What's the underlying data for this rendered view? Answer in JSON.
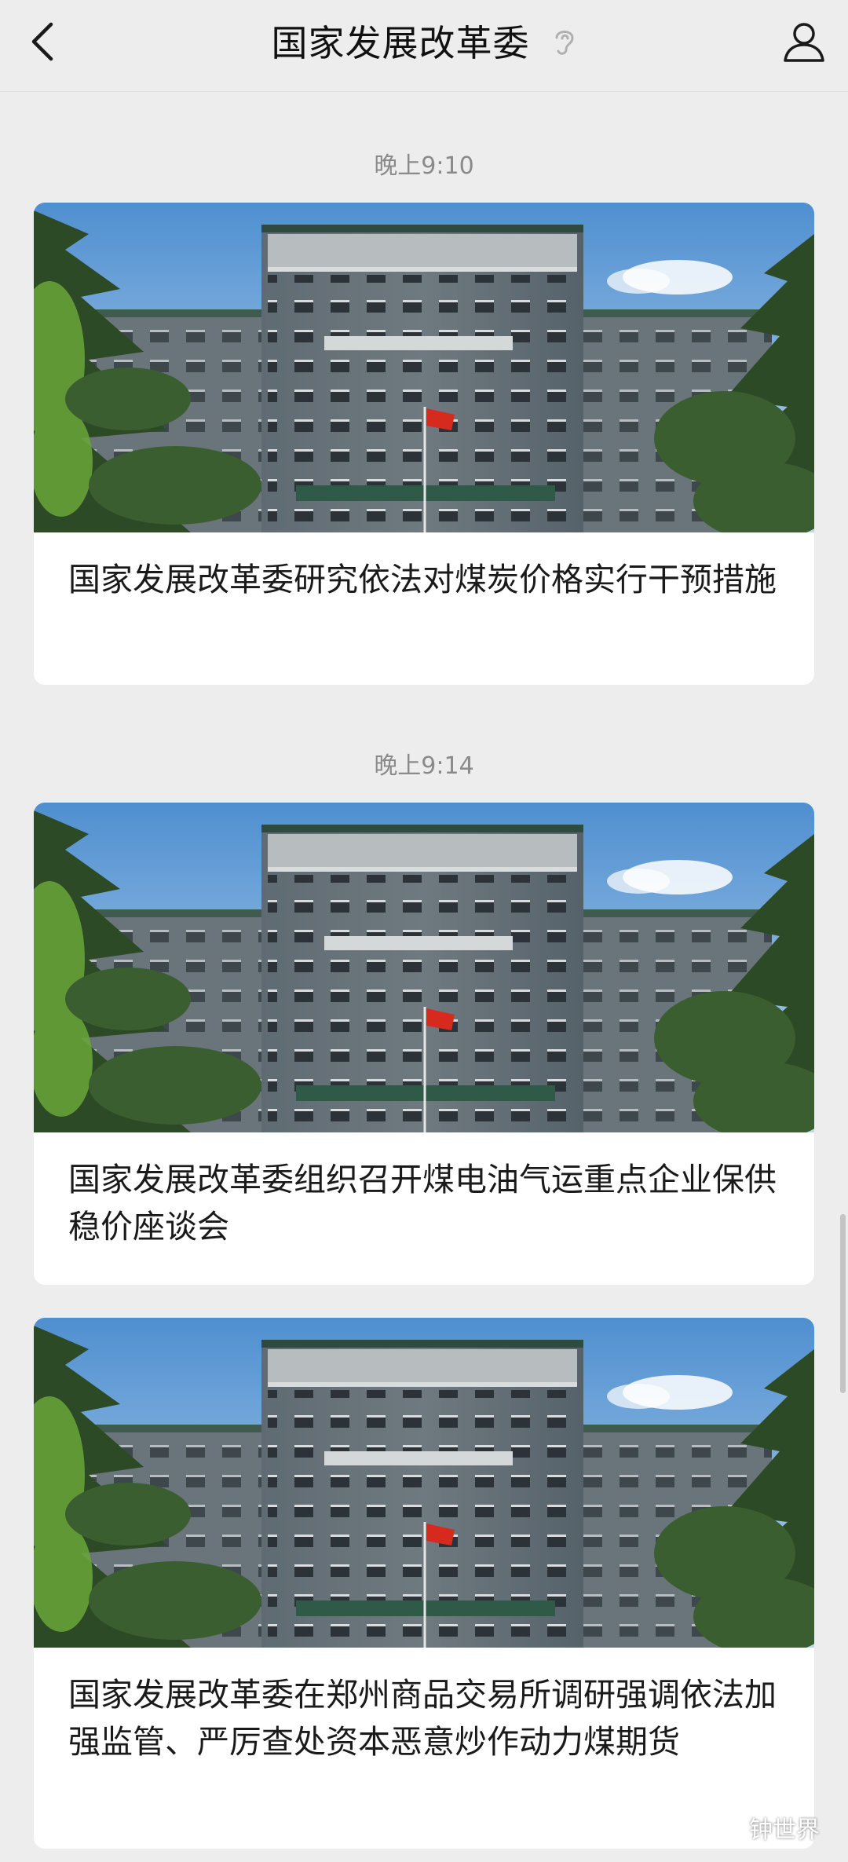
{
  "header": {
    "title": "国家发展改革委",
    "back_icon": "chevron-left-icon",
    "listen_icon": "ear-icon",
    "profile_icon": "person-icon"
  },
  "timeline": [
    {
      "time": "晚上9:10",
      "title": "国家发展改革委研究依法对煤炭价格实行干预措施"
    },
    {
      "time": "晚上9:14",
      "title": "国家发展改革委组织召开煤电油气运重点企业保供稳价座谈会"
    },
    {
      "time": "",
      "title": "国家发展改革委在郑州商品交易所调研强调依法加强监管、严厉查处资本恶意炒作动力煤期货"
    }
  ],
  "watermark": {
    "text": "钟世界"
  }
}
